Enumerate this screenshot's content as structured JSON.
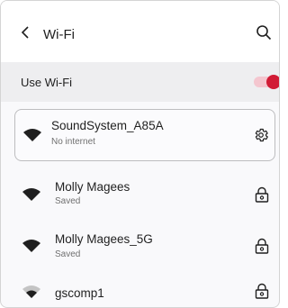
{
  "header": {
    "back_icon": "arrow-back-icon",
    "title": "Wi-Fi",
    "search_icon": "search-icon"
  },
  "use_wifi": {
    "label": "Use Wi-Fi",
    "enabled": true,
    "track_color": "#f4c6cf",
    "thumb_color": "#d11b35"
  },
  "networks": [
    {
      "name": "SoundSystem_A85A",
      "status": "No internet",
      "action_icon": "gear-icon",
      "connected": true,
      "signal": "full"
    },
    {
      "name": "Molly Magees",
      "status": "Saved",
      "action_icon": "lock-icon",
      "connected": false,
      "signal": "full"
    },
    {
      "name": "Molly Magees_5G",
      "status": "Saved",
      "action_icon": "lock-icon",
      "connected": false,
      "signal": "full"
    },
    {
      "name": "gscomp1",
      "status": "",
      "action_icon": "lock-icon",
      "connected": false,
      "signal": "weak"
    }
  ]
}
